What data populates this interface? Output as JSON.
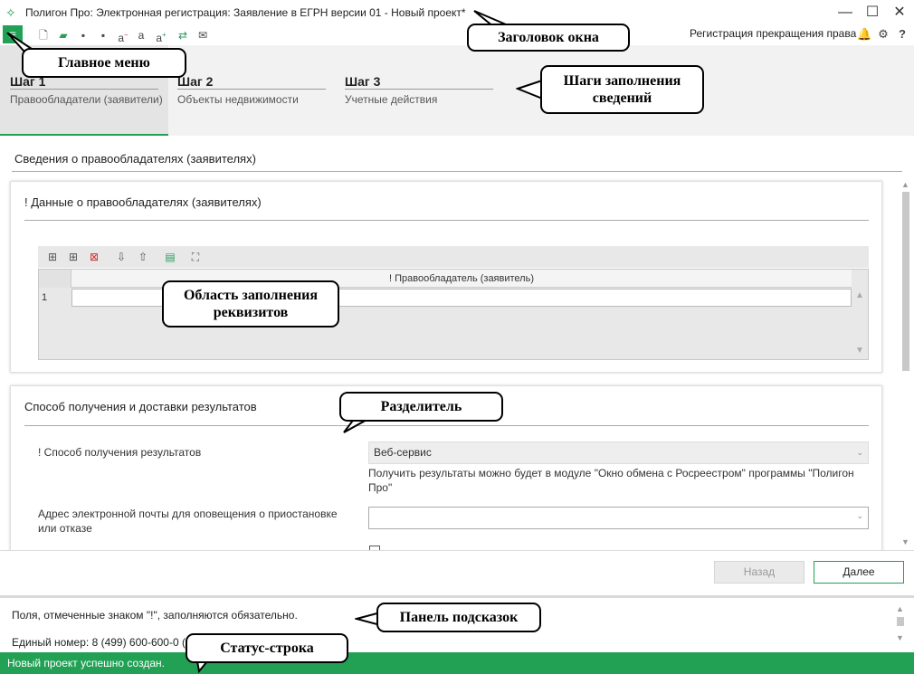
{
  "window": {
    "title": "Полигон Про: Электронная регистрация: Заявление в ЕГРН версии 01 - Новый проект*",
    "minimize_icon": "minimize-icon",
    "maximize_icon": "maximize-icon",
    "close_icon": "close-icon"
  },
  "header": {
    "right_label": "Регистрация прекращения права"
  },
  "steps": [
    {
      "title": "Шаг 1",
      "subtitle": "Правообладатели (заявители)"
    },
    {
      "title": "Шаг 2",
      "subtitle": "Объекты недвижимости"
    },
    {
      "title": "Шаг 3",
      "subtitle": "Учетные действия"
    }
  ],
  "section": {
    "title": "Сведения о правообладателях (заявителях)"
  },
  "card1": {
    "title": "! Данные о правообладателях (заявителях)",
    "grid": {
      "column_header": "! Правообладатель (заявитель)",
      "rows": [
        {
          "num": "1",
          "value": ""
        }
      ]
    }
  },
  "card2": {
    "title": "Способ получения и доставки результатов",
    "method_label": "! Способ получения результатов",
    "method_value": "Веб-сервис",
    "method_hint": "Получить результаты можно будет в модуле \"Окно обмена с Росреестром\" программы \"Полигон Про\"",
    "email_label": "Адрес электронной почты для оповещения о приостановке или отказе",
    "email_value": ""
  },
  "nav": {
    "back_label": "Назад",
    "next_label": "Далее"
  },
  "hint_panel": {
    "text": "Поля, отмеченные знаком \"!\", заполняются обязательно.",
    "text2": "Единый номер: 8 (499) 600-600-0 (с"
  },
  "status": {
    "text": "Новый проект успешно создан."
  },
  "callouts": {
    "main_menu": "Главное меню",
    "window_title": "Заголовок окна",
    "steps": "Шаги заполнения сведений",
    "fill_area": "Область заполнения реквизитов",
    "separator": "Разделитель",
    "hint_panel": "Панель подсказок",
    "status_bar": "Статус-строка"
  },
  "colors": {
    "accent": "#22a155"
  }
}
